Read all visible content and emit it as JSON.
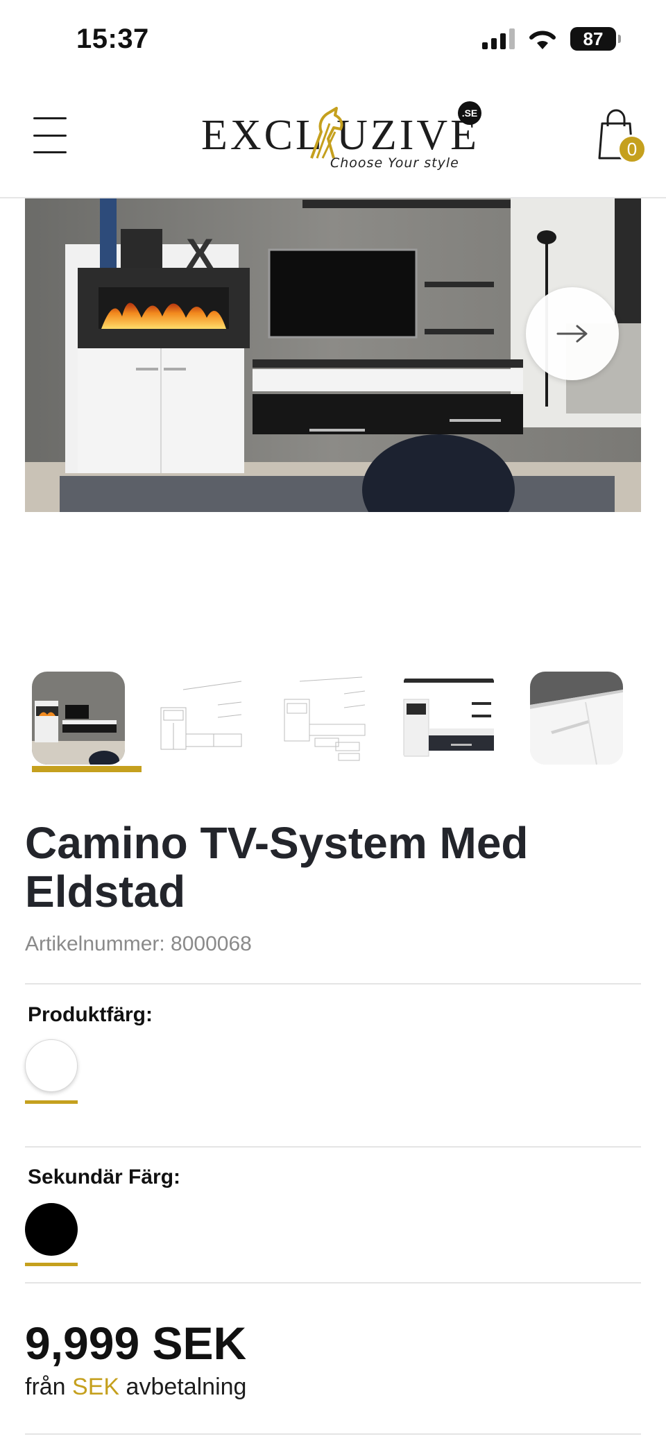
{
  "status_bar": {
    "time": "15:37",
    "battery": "87"
  },
  "header": {
    "logo_text": "EXCL  UZIVE",
    "logo_tld": ".SE",
    "logo_tagline": "Choose Your style",
    "cart_count": "0"
  },
  "product": {
    "title": "Camino TV-System Med Eldstad",
    "sku": "Artikelnummer: 8000068",
    "options": [
      {
        "label": "Produktfärg:",
        "swatch_color": "#ffffff"
      },
      {
        "label": "Sekundär Färg:",
        "swatch_color": "#000000"
      }
    ],
    "price": "9,999 SEK",
    "installment_prefix": "från",
    "installment_currency": "SEK",
    "installment_suffix": "avbetalning"
  },
  "gallery": {
    "thumbnails": [
      "tv-wall-photo",
      "line-drawing-front",
      "line-drawing-exploded",
      "cabinet-open-photo",
      "cabinet-detail-photo"
    ],
    "selected_index": 0
  },
  "colors": {
    "accent": "#c5a01e",
    "text": "#23252b",
    "muted": "#8a8a8a"
  },
  "icons": [
    "menu-icon",
    "cart-icon",
    "arrow-right-icon",
    "signal-icon",
    "wifi-icon",
    "battery-icon"
  ]
}
